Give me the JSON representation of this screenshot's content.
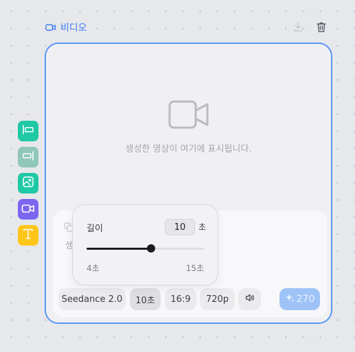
{
  "node": {
    "title": "비디오",
    "download_icon": "download-icon",
    "delete_icon": "trash-icon",
    "accent_color": "#5b95f5"
  },
  "preview": {
    "icon": "video-camera-icon",
    "placeholder": "생성한 영상이 여기에 표시됩니다."
  },
  "prompt": {
    "partial_text": "생"
  },
  "toolbar_items": [
    {
      "name": "align-left-tool",
      "color": "#1fc9a5"
    },
    {
      "name": "align-right-tool",
      "color": "#8fc7b9"
    },
    {
      "name": "image-tool",
      "color": "#1fc9a5"
    },
    {
      "name": "video-tool",
      "color": "#7b66f0"
    },
    {
      "name": "text-tool",
      "color": "#ffc61a"
    }
  ],
  "controls": {
    "model": "Seedance 2.0",
    "duration": "10초",
    "aspect_ratio": "16:9",
    "resolution": "720p",
    "audio_icon": "speaker-icon",
    "generate_credits": "270"
  },
  "length_popover": {
    "label": "길이",
    "value": "10",
    "unit": "초",
    "min_label": "4초",
    "max_label": "15초",
    "min": 4,
    "max": 15,
    "current": 10
  }
}
